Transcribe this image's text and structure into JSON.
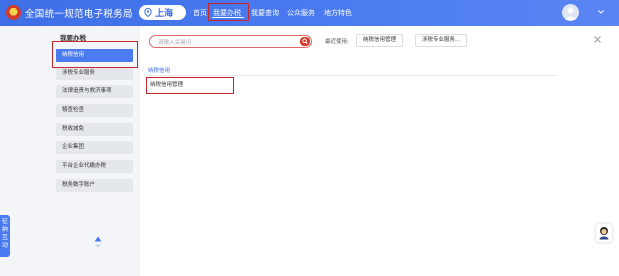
{
  "header": {
    "title": "全国统一规范电子税务局",
    "region": "上海",
    "nav": [
      "首页",
      "我要办税",
      "我要查询",
      "公众服务",
      "地方特色"
    ],
    "active_nav": "我要办税"
  },
  "sidebar": {
    "title": "我要办税",
    "items": [
      {
        "label": "纳税信用",
        "active": true
      },
      {
        "label": "涉税专业服务"
      },
      {
        "label": "法律追责与救济事项"
      },
      {
        "label": "稽查检查"
      },
      {
        "label": "税收减免"
      },
      {
        "label": "企业集团"
      },
      {
        "label": "平台企业代缴办税"
      },
      {
        "label": "税务数字账户"
      }
    ]
  },
  "float_tab": {
    "label": "征纳互动"
  },
  "main": {
    "search_placeholder": "请输入关键词",
    "recent_label": "最近使用:",
    "recent_chips": [
      "纳税信用管理",
      "涉税专业服务..."
    ],
    "section_title": "纳税信用",
    "results": [
      "纳税信用管理"
    ]
  },
  "colors": {
    "header_blue": "#4a7bf0",
    "accent_red": "#c8262f",
    "sidebar_gray": "#e4e7ec",
    "text_blue": "#3f6fe6"
  },
  "icons": {
    "logo": "tax-emblem-icon",
    "region_pin": "location-pin-icon",
    "search": "search-icon",
    "close": "close-icon",
    "avatar": "user-avatar-icon",
    "dropdown": "chevron-down-icon",
    "scroll_up": "triangle-up-icon",
    "scroll_down": "triangle-down-icon",
    "assistant": "assistant-icon"
  }
}
